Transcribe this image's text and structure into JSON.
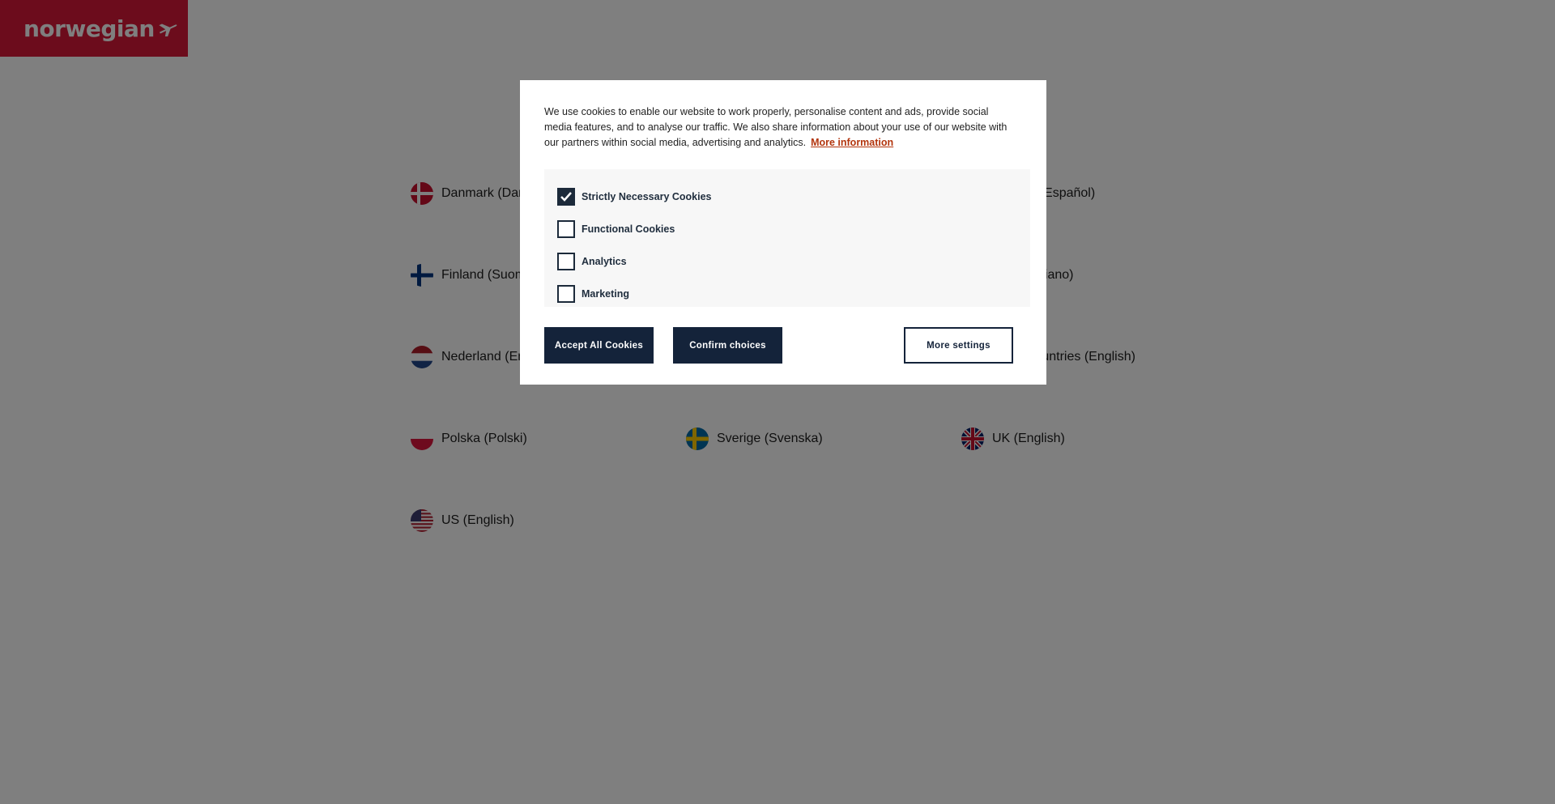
{
  "brand": {
    "logo_text": "norwegian",
    "logo_color": "#d81939"
  },
  "countries": [
    {
      "label": "Danmark (Dansk)",
      "flag": "denmark-flag-icon"
    },
    {
      "label": "España (Español)",
      "flag": "spain-flag-icon"
    },
    {
      "label": "Finland (Suomi)",
      "flag": "finland-flag-icon"
    },
    {
      "label": "Italia (Italiano)",
      "flag": "italy-flag-icon"
    },
    {
      "label": "Nederland (English)",
      "flag": "netherlands-flag-icon"
    },
    {
      "label": "Other countries (English)",
      "flag": "globe-icon"
    },
    {
      "label": "Polska (Polski)",
      "flag": "poland-flag-icon"
    },
    {
      "label": "Sverige (Svenska)",
      "flag": "sweden-flag-icon"
    },
    {
      "label": "UK (English)",
      "flag": "uk-flag-icon"
    },
    {
      "label": "US (English)",
      "flag": "us-flag-icon"
    }
  ],
  "cookie_dialog": {
    "text": "We use cookies to enable our website to work properly, personalise content and ads, provide social media features, and to analyse our traffic. We also share information about your use of our website with our partners within social media, advertising and analytics.",
    "more_info_label": "More information",
    "choices": [
      {
        "label": "Strictly Necessary Cookies",
        "checked": true
      },
      {
        "label": "Functional Cookies",
        "checked": false
      },
      {
        "label": "Analytics",
        "checked": false
      },
      {
        "label": "Marketing",
        "checked": false
      }
    ],
    "accept_all_label": "Accept All Cookies",
    "confirm_label": "Confirm choices",
    "more_settings_label": "More settings",
    "button_color": "#14233a",
    "link_color": "#b3350d"
  }
}
